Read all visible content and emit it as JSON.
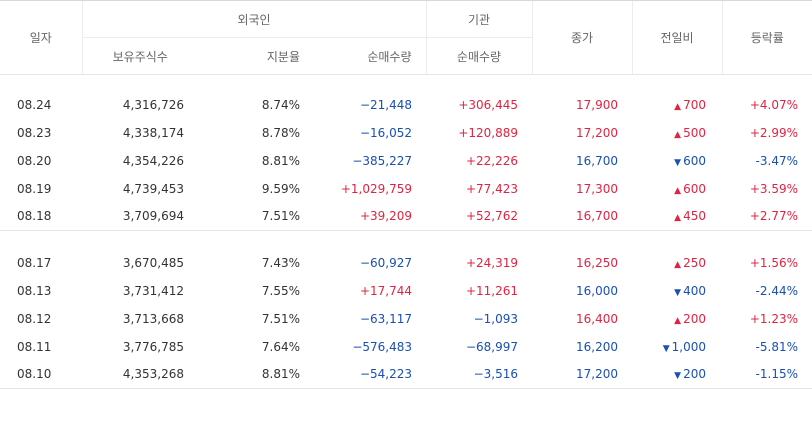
{
  "header": {
    "date": "일자",
    "foreign": "외국인",
    "institution": "기관",
    "close": "종가",
    "change": "전일비",
    "rate": "등락률",
    "holdings": "보유주식수",
    "ratio": "지분율",
    "foreign_net": "순매수량",
    "inst_net": "순매수량"
  },
  "colors": {
    "up": "#e12343",
    "down": "#1a4fb3",
    "border": "#e5e5e5"
  },
  "groups": [
    {
      "rows": [
        {
          "date": "08.24",
          "holdings": "4,316,726",
          "ratio": "8.74%",
          "foreign_net": "−21,448",
          "foreign_dir": "dn",
          "inst_net": "+306,445",
          "inst_dir": "up",
          "close": "17,900",
          "close_dir": "up",
          "change": "700",
          "change_dir": "up",
          "rate": "+4.07%",
          "rate_dir": "up"
        },
        {
          "date": "08.23",
          "holdings": "4,338,174",
          "ratio": "8.78%",
          "foreign_net": "−16,052",
          "foreign_dir": "dn",
          "inst_net": "+120,889",
          "inst_dir": "up",
          "close": "17,200",
          "close_dir": "up",
          "change": "500",
          "change_dir": "up",
          "rate": "+2.99%",
          "rate_dir": "up"
        },
        {
          "date": "08.20",
          "holdings": "4,354,226",
          "ratio": "8.81%",
          "foreign_net": "−385,227",
          "foreign_dir": "dn",
          "inst_net": "+22,226",
          "inst_dir": "up",
          "close": "16,700",
          "close_dir": "dn",
          "change": "600",
          "change_dir": "dn",
          "rate": "-3.47%",
          "rate_dir": "dn"
        },
        {
          "date": "08.19",
          "holdings": "4,739,453",
          "ratio": "9.59%",
          "foreign_net": "+1,029,759",
          "foreign_dir": "up",
          "inst_net": "+77,423",
          "inst_dir": "up",
          "close": "17,300",
          "close_dir": "up",
          "change": "600",
          "change_dir": "up",
          "rate": "+3.59%",
          "rate_dir": "up"
        },
        {
          "date": "08.18",
          "holdings": "3,709,694",
          "ratio": "7.51%",
          "foreign_net": "+39,209",
          "foreign_dir": "up",
          "inst_net": "+52,762",
          "inst_dir": "up",
          "close": "16,700",
          "close_dir": "up",
          "change": "450",
          "change_dir": "up",
          "rate": "+2.77%",
          "rate_dir": "up"
        }
      ]
    },
    {
      "rows": [
        {
          "date": "08.17",
          "holdings": "3,670,485",
          "ratio": "7.43%",
          "foreign_net": "−60,927",
          "foreign_dir": "dn",
          "inst_net": "+24,319",
          "inst_dir": "up",
          "close": "16,250",
          "close_dir": "up",
          "change": "250",
          "change_dir": "up",
          "rate": "+1.56%",
          "rate_dir": "up"
        },
        {
          "date": "08.13",
          "holdings": "3,731,412",
          "ratio": "7.55%",
          "foreign_net": "+17,744",
          "foreign_dir": "up",
          "inst_net": "+11,261",
          "inst_dir": "up",
          "close": "16,000",
          "close_dir": "dn",
          "change": "400",
          "change_dir": "dn",
          "rate": "-2.44%",
          "rate_dir": "dn"
        },
        {
          "date": "08.12",
          "holdings": "3,713,668",
          "ratio": "7.51%",
          "foreign_net": "−63,117",
          "foreign_dir": "dn",
          "inst_net": "−1,093",
          "inst_dir": "dn",
          "close": "16,400",
          "close_dir": "up",
          "change": "200",
          "change_dir": "up",
          "rate": "+1.23%",
          "rate_dir": "up"
        },
        {
          "date": "08.11",
          "holdings": "3,776,785",
          "ratio": "7.64%",
          "foreign_net": "−576,483",
          "foreign_dir": "dn",
          "inst_net": "−68,997",
          "inst_dir": "dn",
          "close": "16,200",
          "close_dir": "dn",
          "change": "1,000",
          "change_dir": "dn",
          "rate": "-5.81%",
          "rate_dir": "dn"
        },
        {
          "date": "08.10",
          "holdings": "4,353,268",
          "ratio": "8.81%",
          "foreign_net": "−54,223",
          "foreign_dir": "dn",
          "inst_net": "−3,516",
          "inst_dir": "dn",
          "close": "17,200",
          "close_dir": "dn",
          "change": "200",
          "change_dir": "dn",
          "rate": "-1.15%",
          "rate_dir": "dn"
        }
      ]
    }
  ]
}
